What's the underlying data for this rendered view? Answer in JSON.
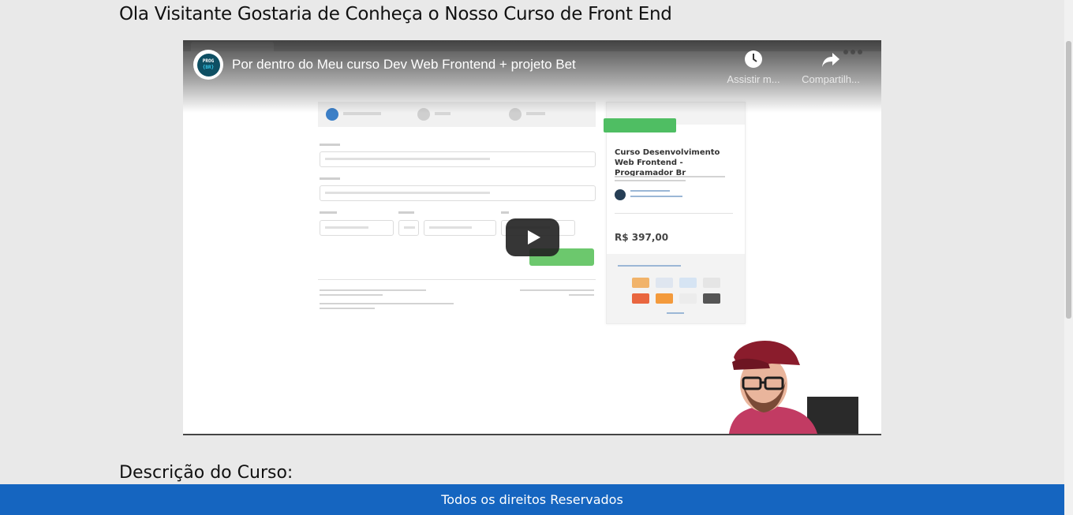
{
  "page": {
    "title": "Ola Visitante Gostaria de Conheça o Nosso Curso de Front End",
    "section_title": "Descrição do Curso:"
  },
  "video": {
    "title": "Por dentro do Meu curso Dev Web Frontend + projeto Bet",
    "channel_logo_line1": "PROG",
    "channel_logo_line2": "{BR}",
    "watch_later_label": "Assistir m...",
    "share_label": "Compartilh...",
    "thumbnail": {
      "course_name": "Curso Desenvolvimento Web Frontend - Programador Br",
      "price": "R$ 397,00"
    }
  },
  "footer": {
    "text": "Todos os direitos Reservados"
  },
  "colors": {
    "footer_bg": "#1565c0",
    "page_bg": "#e9e9e9"
  }
}
